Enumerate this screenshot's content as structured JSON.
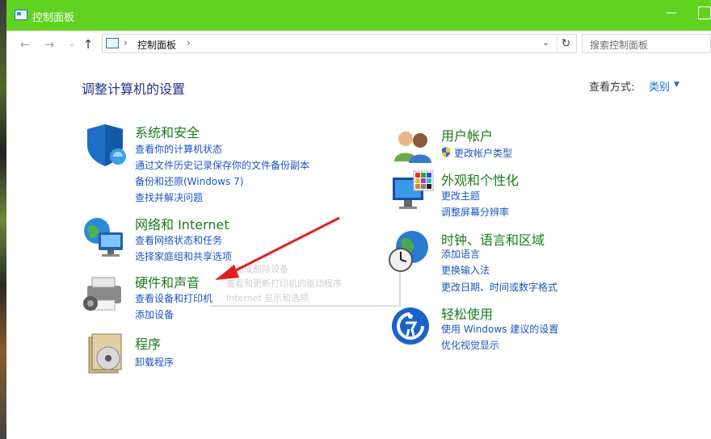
{
  "window": {
    "title": "控制面板",
    "min_label": "—"
  },
  "address": {
    "up_label": "↑",
    "back_label": "←",
    "forward_label": "→",
    "history_label": "⌄",
    "path_sep": "›",
    "path_item": "控制面板",
    "dropdown_label": "⌄",
    "refresh_label": "↻",
    "search_placeholder": "搜索控制面板"
  },
  "main": {
    "heading": "调整计算机的设置",
    "view_by_label": "查看方式:",
    "view_by_value": "类别",
    "view_by_arrow": "▼"
  },
  "categories": [
    {
      "title": "系统和安全",
      "icon": "shield-icon",
      "links": [
        "查看你的计算机状态",
        "通过文件历史记录保存你的文件备份副本",
        "备份和还原(Windows 7)",
        "查找并解决问题"
      ]
    },
    {
      "title": "网络和 Internet",
      "icon": "network-globe-icon",
      "links": [
        "查看网络状态和任务",
        "选择家庭组和共享选项"
      ]
    },
    {
      "title": "硬件和声音",
      "icon": "printer-icon",
      "links": [
        "查看设备和打印机",
        "添加设备"
      ]
    },
    {
      "title": "程序",
      "icon": "programs-disc-icon",
      "links": [
        "卸载程序"
      ]
    },
    {
      "title": "用户帐户",
      "icon": "users-icon",
      "links": [
        "更改帐户类型"
      ]
    },
    {
      "title": "外观和个性化",
      "icon": "monitor-palette-icon",
      "links": [
        "更改主题",
        "调整屏幕分辨率"
      ]
    },
    {
      "title": "时钟、语言和区域",
      "icon": "clock-globe-icon",
      "links": [
        "添加语言",
        "更换输入法",
        "更改日期、时间或数字格式"
      ]
    },
    {
      "title": "轻松使用",
      "icon": "ease-of-access-icon",
      "links": [
        "使用 Windows 建议的设置",
        "优化视觉显示"
      ]
    }
  ],
  "ghost_tooltip": {
    "line1": "添加或删除设备",
    "line2": "查看和更新打印机的驱动程序",
    "line3": "Internet 显示和选项"
  },
  "colors": {
    "titlebar": "#5fd320",
    "category_title": "#1a7a1a",
    "link": "#1a55c0",
    "heading": "#1e3287",
    "arrow": "#e02020"
  }
}
